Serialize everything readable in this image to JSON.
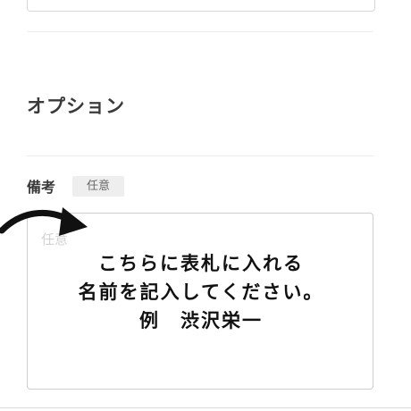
{
  "section": {
    "title": "オプション"
  },
  "remarks": {
    "label": "備考",
    "badge": "任意",
    "placeholder": "任意",
    "note_lines": [
      "こちらに表札に入れる",
      "名前を記入してください。",
      "例　渋沢栄一"
    ]
  },
  "colors": {
    "accent_text": "#333333",
    "border": "#cfcfcf",
    "badge_bg": "#eeeeee"
  },
  "icons": {
    "pointer": "hand-drawn-arrow-icon"
  }
}
